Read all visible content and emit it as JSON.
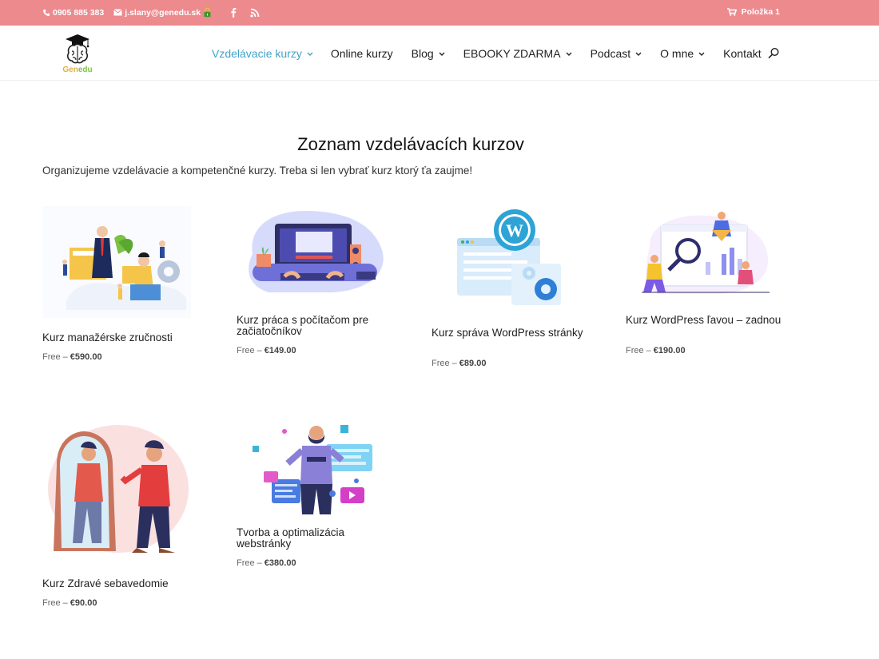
{
  "topbar": {
    "phone": "0905 885 383",
    "email": "j.slany@genedu.sk",
    "cart_label": "Položka 1"
  },
  "logo": {
    "part1": "Gen",
    "part2": "edu"
  },
  "nav": {
    "items": [
      {
        "label": "Vzdelávacie kurzy"
      },
      {
        "label": "Online kurzy"
      },
      {
        "label": "Blog"
      },
      {
        "label": "EBOOKY ZDARMA"
      },
      {
        "label": "Podcast"
      },
      {
        "label": "O mne"
      },
      {
        "label": "Kontakt"
      }
    ]
  },
  "page": {
    "title": "Zoznam vzdelávacích kurzov",
    "intro": "Organizujeme vzdelávacie a kompetenčné kurzy. Treba si len vybrať kurz ktorý ťa zaujme!"
  },
  "products": [
    {
      "name": "Kurz manažérske zručnosti",
      "free": "Free –",
      "price": "€590.00"
    },
    {
      "name": "Kurz práca s počítačom pre začiatočníkov",
      "free": "Free –",
      "price": "€149.00"
    },
    {
      "name": "Kurz správa WordPress stránky",
      "free": "Free –",
      "price": "€89.00"
    },
    {
      "name": "Kurz WordPress ľavou – zadnou",
      "free": "Free –",
      "price": "€190.00"
    },
    {
      "name": "Kurz Zdravé sebavedomie",
      "free": "Free –",
      "price": "€90.00"
    },
    {
      "name": "Tvorba a optimalizácia webstránky",
      "free": "Free –",
      "price": "€380.00"
    }
  ],
  "colors": {
    "topbar": "#ec8a8e",
    "nav_active": "#3fa3c9",
    "wordpress_blue": "#2ea3d6"
  },
  "icons": [
    "phone-icon",
    "mail-icon",
    "lock-icon",
    "facebook-icon",
    "rss-icon",
    "cart-icon",
    "search-icon",
    "chevron-down-icon"
  ]
}
